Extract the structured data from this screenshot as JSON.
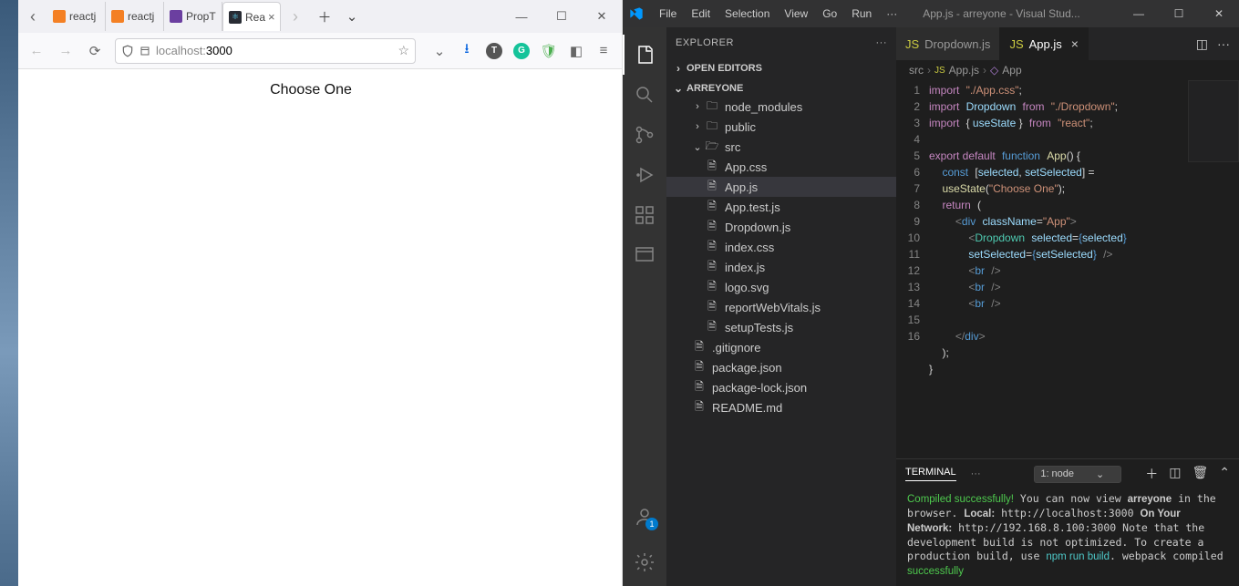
{
  "browser": {
    "tabs": [
      {
        "label": "reactj"
      },
      {
        "label": "reactj"
      },
      {
        "label": "PropT"
      },
      {
        "label": "Rea"
      }
    ],
    "url_host": "localhost:",
    "url_port": "3000"
  },
  "page": {
    "dropdown_label": "Choose One"
  },
  "vscode": {
    "menus": [
      "File",
      "Edit",
      "Selection",
      "View",
      "Go",
      "Run",
      "···"
    ],
    "title": "App.js - arreyone - Visual Stud...",
    "explorer_label": "EXPLORER",
    "open_editors": "OPEN EDITORS",
    "project": "ARREYONE",
    "tree": {
      "node_modules": "node_modules",
      "public": "public",
      "src": "src",
      "files": [
        "App.css",
        "App.js",
        "App.test.js",
        "Dropdown.js",
        "index.css",
        "index.js",
        "logo.svg",
        "reportWebVitals.js",
        "setupTests.js"
      ],
      "root_files": [
        ".gitignore",
        "package.json",
        "package-lock.json",
        "README.md"
      ]
    },
    "editor_tabs": [
      {
        "label": "Dropdown.js",
        "active": false
      },
      {
        "label": "App.js",
        "active": true
      }
    ],
    "breadcrumb": [
      "src",
      "App.js",
      "App"
    ],
    "line_numbers": [
      "1",
      "2",
      "3",
      "4",
      "5",
      "6",
      "7",
      "8",
      "9",
      "10",
      "11",
      "12",
      "13",
      "14",
      "15",
      "16"
    ],
    "panel": {
      "tab": "TERMINAL",
      "select": "1: node",
      "lines": [
        "Compiled successfully!",
        "",
        "You can now view arreyone in the browser.",
        "",
        "  Local:            http://localhost:3000",
        "  On Your Network:  http://192.168.8.100:3000",
        "",
        "Note that the development build is not optimized.",
        "To create a production build, use npm run build.",
        "",
        "webpack compiled successfully"
      ]
    },
    "account_badge": "1"
  }
}
